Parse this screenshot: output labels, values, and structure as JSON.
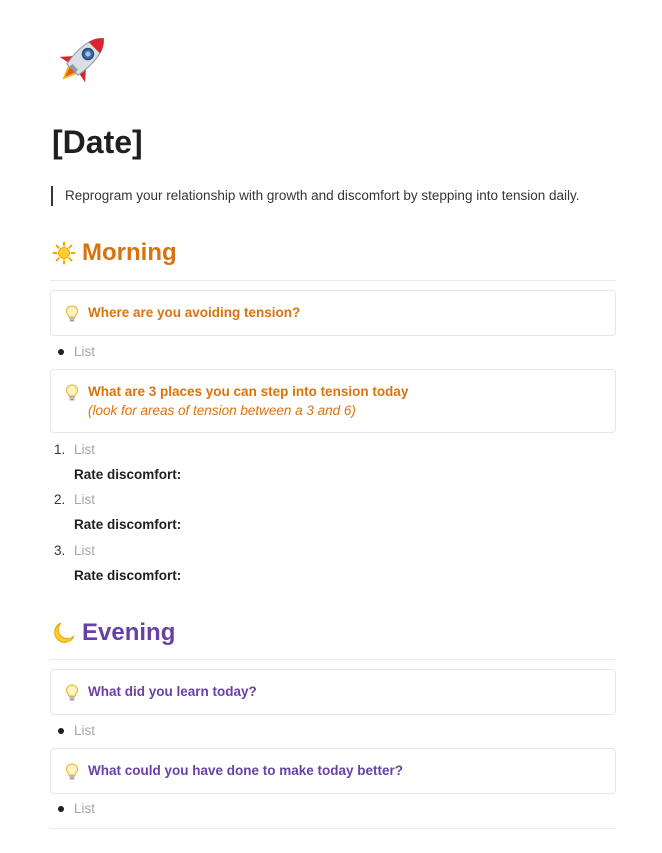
{
  "page": {
    "icon": "rocket-icon",
    "title": "[Date]",
    "quote": "Reprogram your relationship with growth and discomfort by stepping into tension daily."
  },
  "colors": {
    "morning_accent": "#d9730d",
    "evening_accent": "#6940a5",
    "text": "#37352f",
    "placeholder": "#a6a6a3",
    "border": "#e6e6e4"
  },
  "morning": {
    "icon": "sun-icon",
    "heading": "Morning",
    "callouts": [
      {
        "icon": "lightbulb-icon",
        "text": "Where are you avoiding tension?"
      },
      {
        "icon": "lightbulb-icon",
        "text": "What are 3 places you can step into tension today",
        "subtext": "(look for areas of tension between a 3 and 6)"
      }
    ],
    "bullet_placeholder": "List",
    "numbered_items": [
      {
        "number": "1.",
        "placeholder": "List",
        "rate_label": "Rate discomfort:"
      },
      {
        "number": "2.",
        "placeholder": "List",
        "rate_label": "Rate discomfort:"
      },
      {
        "number": "3.",
        "placeholder": "List",
        "rate_label": "Rate discomfort:"
      }
    ]
  },
  "evening": {
    "icon": "moon-icon",
    "heading": "Evening",
    "callouts": [
      {
        "icon": "lightbulb-icon",
        "text": "What did you learn today?",
        "bullet_placeholder": "List"
      },
      {
        "icon": "lightbulb-icon",
        "text": "What could you have done to make today better?",
        "bullet_placeholder": "List"
      }
    ]
  }
}
